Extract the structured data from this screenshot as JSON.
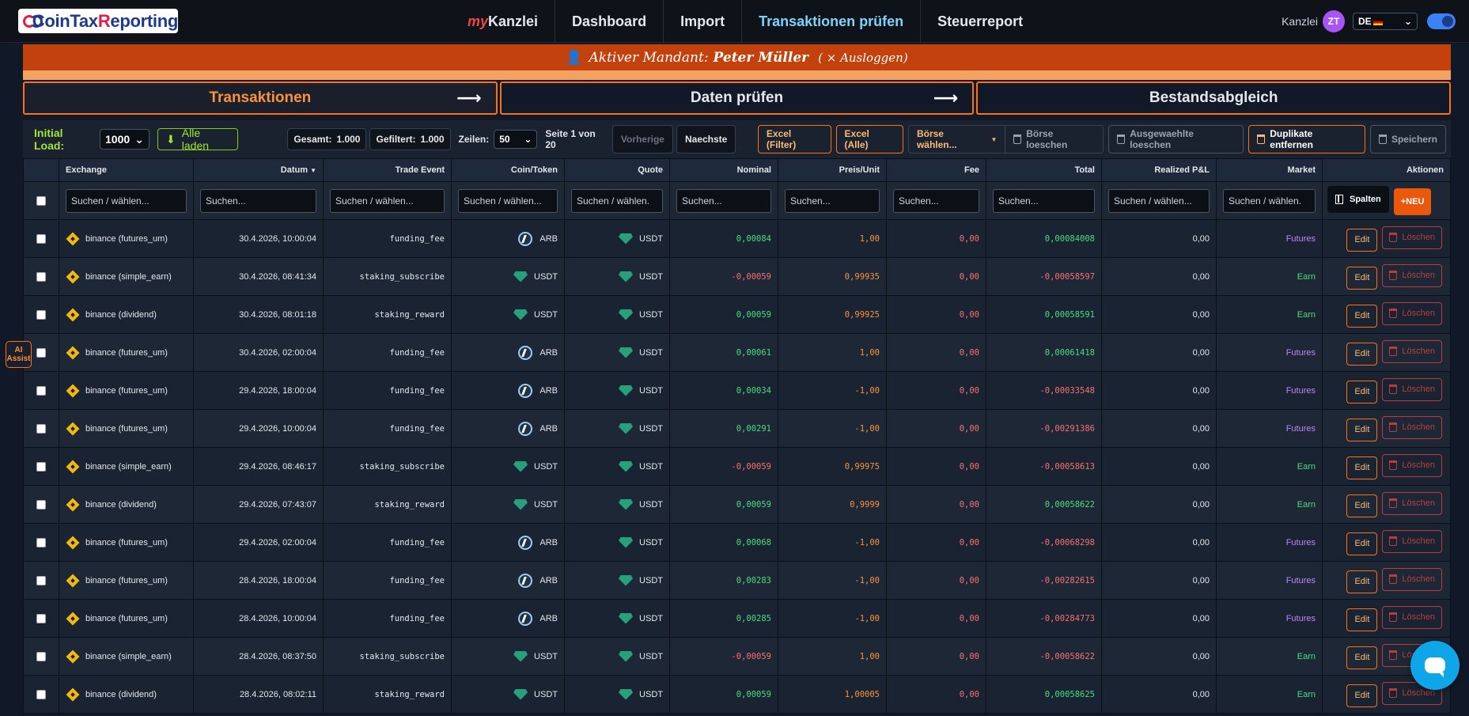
{
  "app": {
    "logo_text_a": "Coin",
    "logo_text_b": "Tax",
    "logo_text_c": "R",
    "logo_text_d": "eporting"
  },
  "nav": {
    "my": "my",
    "kanzlei": "Kanzlei",
    "items": [
      "Dashboard",
      "Import",
      "Transaktionen prüfen",
      "Steuerreport"
    ]
  },
  "header_right": {
    "kanzlei_label": "Kanzlei",
    "avatar_initials": "ZT",
    "language": "DE"
  },
  "mandant": {
    "prefix": "Aktiver Mandant:",
    "name": "Peter Müller",
    "logout": "( × Ausloggen)"
  },
  "steps": [
    "Transaktionen",
    "Daten prüfen",
    "Bestandsabgleich"
  ],
  "toolbar": {
    "initial_load_label": "Initial Load:",
    "initial_load_value": "1000",
    "alle_laden": "Alle laden",
    "gesamt_label": "Gesamt:",
    "gesamt_value": "1.000",
    "gefiltert_label": "Gefiltert:",
    "gefiltert_value": "1.000",
    "zeilen_label": "Zeilen:",
    "zeilen_value": "50",
    "seite": "Seite 1 von 20",
    "vorherige": "Vorherige",
    "naechste": "Naechste",
    "excel_filter": "Excel (Filter)",
    "excel_alle": "Excel (Alle)",
    "boerse_waehlen": "Börse wählen...",
    "boerse_loeschen": "Börse loeschen",
    "ausgewaehlte_loeschen": "Ausgewaehlte loeschen",
    "duplikate_entfernen": "Duplikate entfernen",
    "speichern": "Speichern"
  },
  "table": {
    "headers": [
      "Exchange",
      "Datum",
      "Trade Event",
      "Coin/Token",
      "Quote",
      "Nominal",
      "Preis/Unit",
      "Fee",
      "Total",
      "Realized P&L",
      "Market",
      "Aktionen"
    ],
    "filters": [
      "Suchen / wählen...",
      "Suchen...",
      "Suchen / wählen...",
      "Suchen / wählen...",
      "Suchen / wählen.",
      "Suchen...",
      "Suchen...",
      "Suchen...",
      "Suchen...",
      "Suchen / wählen...",
      "Suchen / wählen."
    ],
    "spalten": "Spalten",
    "neu": "+NEU",
    "edit": "Edit",
    "loeschen": "Löschen",
    "rows": [
      {
        "exchange": "binance (futures_um)",
        "datum": "30.4.2026, 10:00:04",
        "event": "funding_fee",
        "coin": "ARB",
        "quote": "USDT",
        "nominal": "0,00084",
        "preis": "1,00",
        "fee": "0,00",
        "total": "0,00084008",
        "pnl": "0,00",
        "market": "Futures"
      },
      {
        "exchange": "binance (simple_earn)",
        "datum": "30.4.2026, 08:41:34",
        "event": "staking_subscribe",
        "coin": "USDT",
        "quote": "USDT",
        "nominal": "-0,00059",
        "preis": "0,99935",
        "fee": "0,00",
        "total": "-0,00058597",
        "pnl": "0,00",
        "market": "Earn"
      },
      {
        "exchange": "binance (dividend)",
        "datum": "30.4.2026, 08:01:18",
        "event": "staking_reward",
        "coin": "USDT",
        "quote": "USDT",
        "nominal": "0,00059",
        "preis": "0,99925",
        "fee": "0,00",
        "total": "0,00058591",
        "pnl": "0,00",
        "market": "Earn"
      },
      {
        "exchange": "binance (futures_um)",
        "datum": "30.4.2026, 02:00:04",
        "event": "funding_fee",
        "coin": "ARB",
        "quote": "USDT",
        "nominal": "0,00061",
        "preis": "1,00",
        "fee": "0,00",
        "total": "0,00061418",
        "pnl": "0,00",
        "market": "Futures"
      },
      {
        "exchange": "binance (futures_um)",
        "datum": "29.4.2026, 18:00:04",
        "event": "funding_fee",
        "coin": "ARB",
        "quote": "USDT",
        "nominal": "0,00034",
        "preis": "-1,00",
        "fee": "0,00",
        "total": "-0,00033548",
        "pnl": "0,00",
        "market": "Futures"
      },
      {
        "exchange": "binance (futures_um)",
        "datum": "29.4.2026, 10:00:04",
        "event": "funding_fee",
        "coin": "ARB",
        "quote": "USDT",
        "nominal": "0,00291",
        "preis": "-1,00",
        "fee": "0,00",
        "total": "-0,00291386",
        "pnl": "0,00",
        "market": "Futures"
      },
      {
        "exchange": "binance (simple_earn)",
        "datum": "29.4.2026, 08:46:17",
        "event": "staking_subscribe",
        "coin": "USDT",
        "quote": "USDT",
        "nominal": "-0,00059",
        "preis": "0,99975",
        "fee": "0,00",
        "total": "-0,00058613",
        "pnl": "0,00",
        "market": "Earn"
      },
      {
        "exchange": "binance (dividend)",
        "datum": "29.4.2026, 07:43:07",
        "event": "staking_reward",
        "coin": "USDT",
        "quote": "USDT",
        "nominal": "0,00059",
        "preis": "0,9999",
        "fee": "0,00",
        "total": "0,00058622",
        "pnl": "0,00",
        "market": "Earn"
      },
      {
        "exchange": "binance (futures_um)",
        "datum": "29.4.2026, 02:00:04",
        "event": "funding_fee",
        "coin": "ARB",
        "quote": "USDT",
        "nominal": "0,00068",
        "preis": "-1,00",
        "fee": "0,00",
        "total": "-0,00068298",
        "pnl": "0,00",
        "market": "Futures"
      },
      {
        "exchange": "binance (futures_um)",
        "datum": "28.4.2026, 18:00:04",
        "event": "funding_fee",
        "coin": "ARB",
        "quote": "USDT",
        "nominal": "0,00283",
        "preis": "-1,00",
        "fee": "0,00",
        "total": "-0,00282615",
        "pnl": "0,00",
        "market": "Futures"
      },
      {
        "exchange": "binance (futures_um)",
        "datum": "28.4.2026, 10:00:04",
        "event": "funding_fee",
        "coin": "ARB",
        "quote": "USDT",
        "nominal": "0,00285",
        "preis": "-1,00",
        "fee": "0,00",
        "total": "-0,00284773",
        "pnl": "0,00",
        "market": "Futures"
      },
      {
        "exchange": "binance (simple_earn)",
        "datum": "28.4.2026, 08:37:50",
        "event": "staking_subscribe",
        "coin": "USDT",
        "quote": "USDT",
        "nominal": "-0,00059",
        "preis": "1,00",
        "fee": "0,00",
        "total": "-0,00058622",
        "pnl": "0,00",
        "market": "Earn"
      },
      {
        "exchange": "binance (dividend)",
        "datum": "28.4.2026, 08:02:11",
        "event": "staking_reward",
        "coin": "USDT",
        "quote": "USDT",
        "nominal": "0,00059",
        "preis": "1,00005",
        "fee": "0,00",
        "total": "0,00058625",
        "pnl": "0,00",
        "market": "Earn"
      }
    ]
  },
  "ai_assist": "AI Assist",
  "colors": {
    "accent": "#f97316",
    "active_nav": "#7dd3fc",
    "positive": "#4ade80",
    "negative": "#f87171",
    "futures": "#c084fc"
  }
}
